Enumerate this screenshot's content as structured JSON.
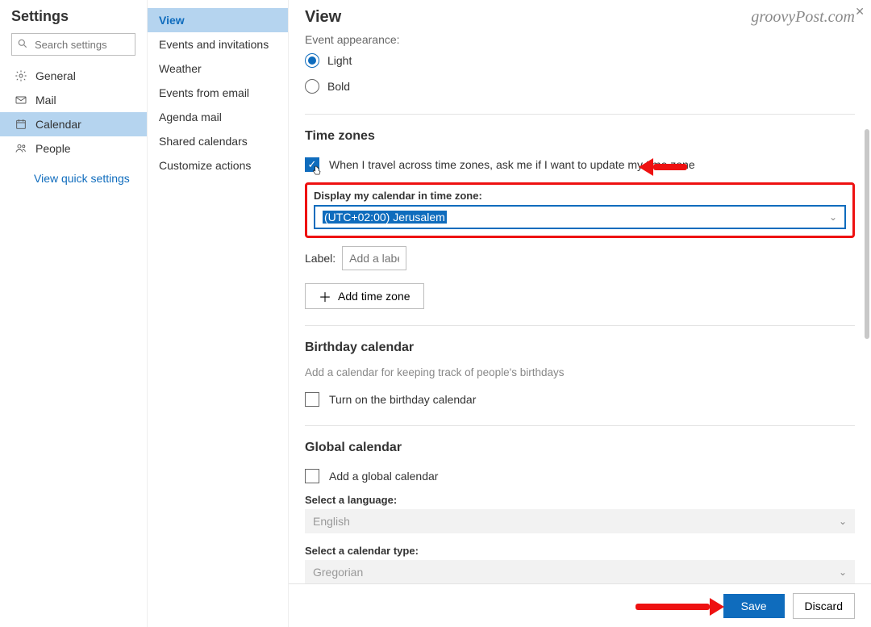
{
  "header": {
    "title": "Settings"
  },
  "search": {
    "placeholder": "Search settings"
  },
  "nav": {
    "general": "General",
    "mail": "Mail",
    "calendar": "Calendar",
    "people": "People",
    "quick": "View quick settings"
  },
  "subnav": {
    "view": "View",
    "events_inv": "Events and invitations",
    "weather": "Weather",
    "events_email": "Events from email",
    "agenda": "Agenda mail",
    "shared": "Shared calendars",
    "customize": "Customize actions"
  },
  "main": {
    "title": "View",
    "watermark": "groovyPost.com",
    "event_appearance": {
      "heading": "Event appearance:",
      "light": "Light",
      "bold": "Bold"
    },
    "timezones": {
      "heading": "Time zones",
      "travel_check": "When I travel across time zones, ask me if I want to update my time zone",
      "display_label": "Display my calendar in time zone:",
      "selected": "(UTC+02:00) Jerusalem",
      "label_text": "Label:",
      "label_placeholder": "Add a label",
      "add_btn": "Add time zone"
    },
    "birthday": {
      "heading": "Birthday calendar",
      "desc": "Add a calendar for keeping track of people's birthdays",
      "check": "Turn on the birthday calendar"
    },
    "global": {
      "heading": "Global calendar",
      "check": "Add a global calendar",
      "lang_label": "Select a language:",
      "lang_value": "English",
      "type_label": "Select a calendar type:",
      "type_value": "Gregorian"
    }
  },
  "footer": {
    "save": "Save",
    "discard": "Discard"
  }
}
